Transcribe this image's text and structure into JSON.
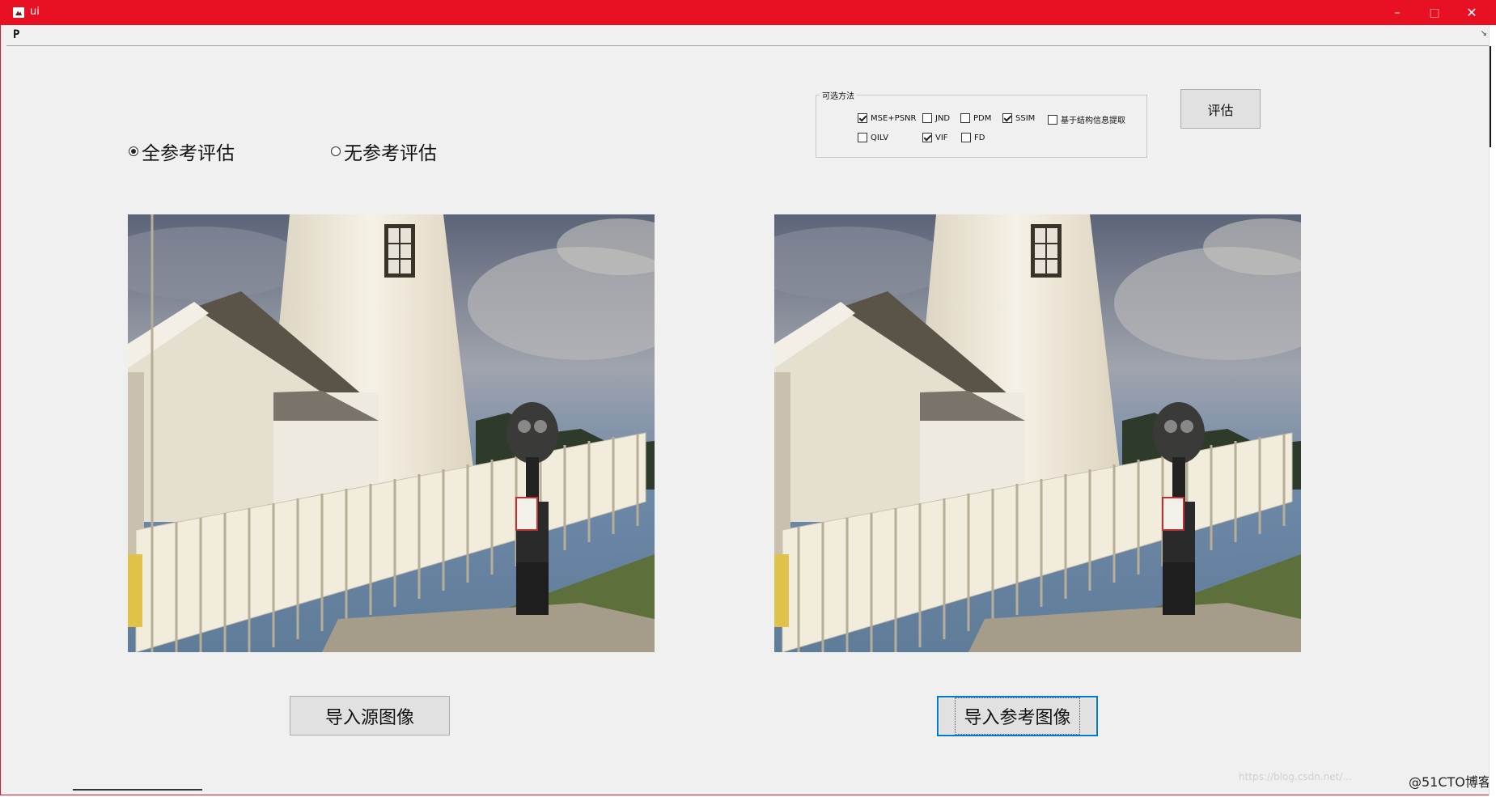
{
  "window": {
    "title": "ui",
    "accent_color": "#e81123",
    "controls": {
      "minimize": "–",
      "maximize": "□",
      "close": "✕"
    }
  },
  "menubar": {
    "item": "P",
    "dock_glyph": "↘"
  },
  "mode": {
    "options": [
      {
        "label": "全参考评估",
        "selected": true
      },
      {
        "label": "无参考评估",
        "selected": false
      }
    ]
  },
  "methods": {
    "group_label": "可选方法",
    "options": [
      {
        "label": "MSE+PSNR",
        "checked": true
      },
      {
        "label": "JND",
        "checked": false
      },
      {
        "label": "PDM",
        "checked": false
      },
      {
        "label": "SSIM",
        "checked": true
      },
      {
        "label": "基于结构信息提取",
        "checked": false
      },
      {
        "label": "QILV",
        "checked": false
      },
      {
        "label": "VIF",
        "checked": true
      },
      {
        "label": "FD",
        "checked": false
      }
    ]
  },
  "buttons": {
    "evaluate": "评估",
    "import_source": "导入源图像",
    "import_reference": "导入参考图像"
  },
  "images": {
    "source": "lighthouse-photo",
    "reference": "lighthouse-photo"
  },
  "watermark": {
    "faint": "https://blog.csdn.net/...",
    "brand": "@51CTO博客"
  }
}
